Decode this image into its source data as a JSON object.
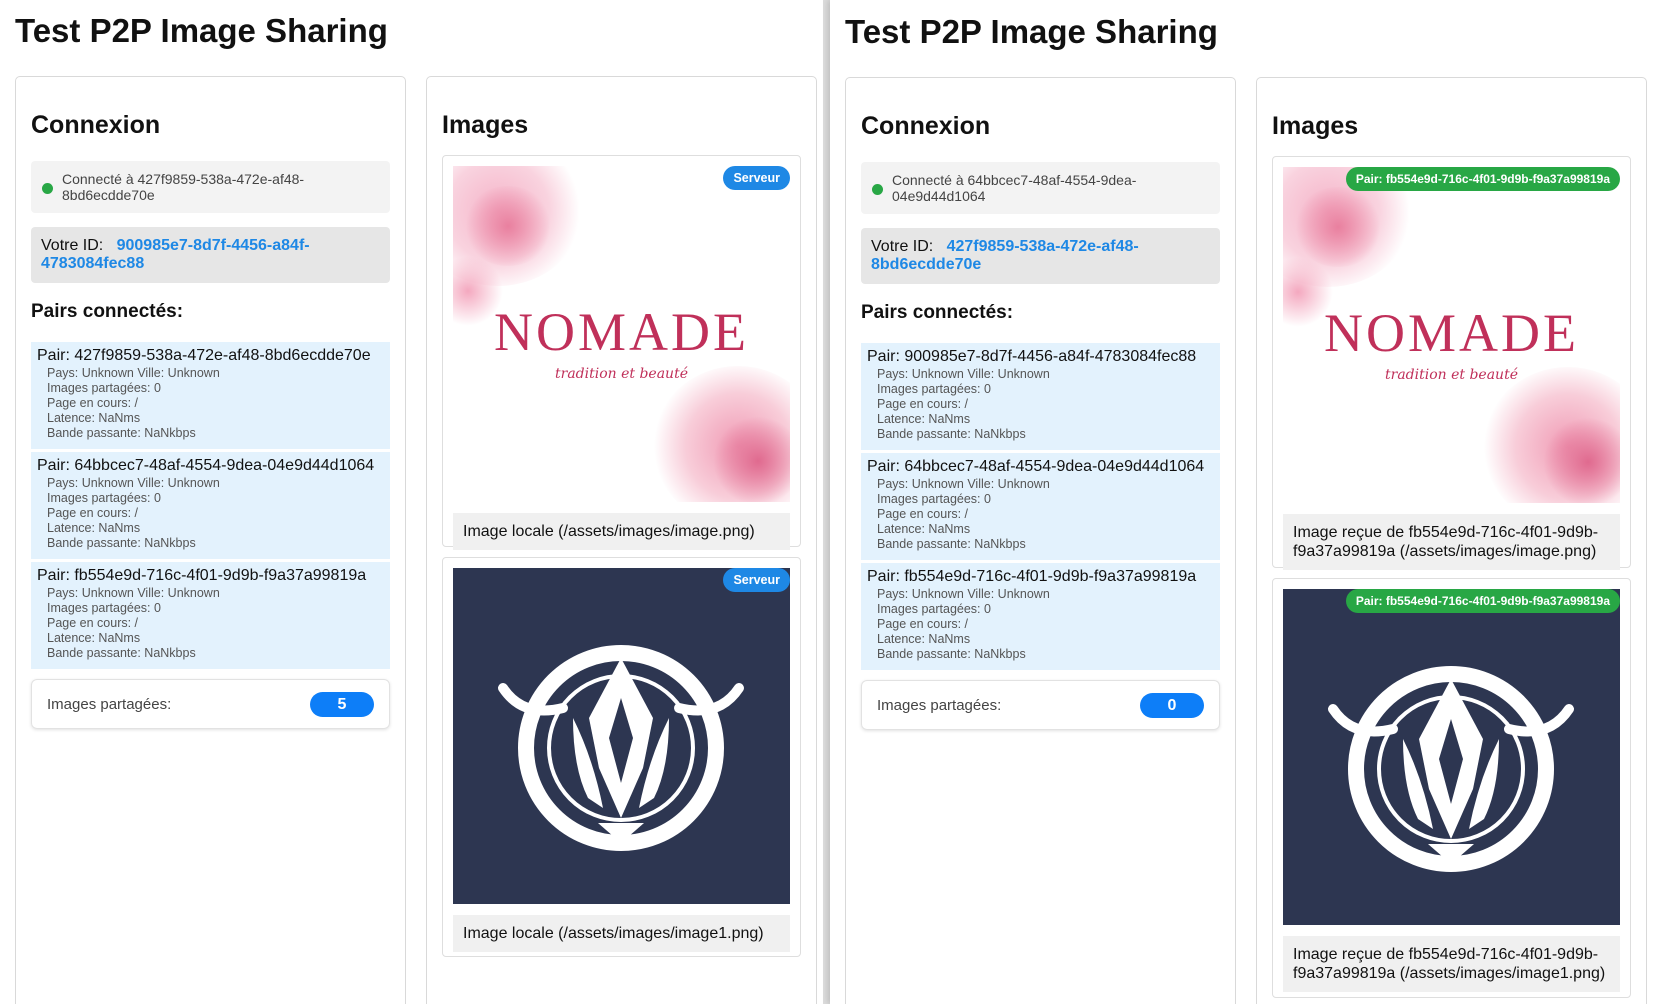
{
  "left": {
    "title": "Test P2P Image Sharing",
    "connection": {
      "heading": "Connexion",
      "status_text": "Connecté à 427f9859-538a-472e-af48-8bd6ecdde70e",
      "my_id_label": "Votre ID:",
      "my_id": "900985e7-8d7f-4456-a84f-4783084fec88",
      "peers_heading": "Pairs connectés:",
      "peers": [
        {
          "title": "Pair: 427f9859-538a-472e-af48-8bd6ecdde70e",
          "location": "Pays: Unknown Ville: Unknown",
          "shared": "Images partagées: 0",
          "page": "Page en cours: /",
          "latency": "Latence: NaNms",
          "bandwidth": "Bande passante: NaNkbps"
        },
        {
          "title": "Pair: 64bbcec7-48af-4554-9dea-04e9d44d1064",
          "location": "Pays: Unknown Ville: Unknown",
          "shared": "Images partagées: 0",
          "page": "Page en cours: /",
          "latency": "Latence: NaNms",
          "bandwidth": "Bande passante: NaNkbps"
        },
        {
          "title": "Pair: fb554e9d-716c-4f01-9d9b-f9a37a99819a",
          "location": "Pays: Unknown Ville: Unknown",
          "shared": "Images partagées: 0",
          "page": "Page en cours: /",
          "latency": "Latence: NaNms",
          "bandwidth": "Bande passante: NaNkbps"
        }
      ],
      "counter_label": "Images partagées:",
      "counter_value": "5"
    },
    "images": {
      "heading": "Images",
      "cards": [
        {
          "badge": "Serveur",
          "caption": "Image locale (/assets/images/image.png)",
          "logo_text": "NOMADE",
          "logo_sub": "tradition et beauté"
        },
        {
          "badge": "Serveur",
          "caption": "Image locale (/assets/images/image1.png)"
        }
      ]
    }
  },
  "right": {
    "title": "Test P2P Image Sharing",
    "connection": {
      "heading": "Connexion",
      "status_text": "Connecté à 64bbcec7-48af-4554-9dea-04e9d44d1064",
      "my_id_label": "Votre ID:",
      "my_id": "427f9859-538a-472e-af48-8bd6ecdde70e",
      "peers_heading": "Pairs connectés:",
      "peers": [
        {
          "title": "Pair: 900985e7-8d7f-4456-a84f-4783084fec88",
          "location": "Pays: Unknown Ville: Unknown",
          "shared": "Images partagées: 0",
          "page": "Page en cours: /",
          "latency": "Latence: NaNms",
          "bandwidth": "Bande passante: NaNkbps"
        },
        {
          "title": "Pair: 64bbcec7-48af-4554-9dea-04e9d44d1064",
          "location": "Pays: Unknown Ville: Unknown",
          "shared": "Images partagées: 0",
          "page": "Page en cours: /",
          "latency": "Latence: NaNms",
          "bandwidth": "Bande passante: NaNkbps"
        },
        {
          "title": "Pair: fb554e9d-716c-4f01-9d9b-f9a37a99819a",
          "location": "Pays: Unknown Ville: Unknown",
          "shared": "Images partagées: 0",
          "page": "Page en cours: /",
          "latency": "Latence: NaNms",
          "bandwidth": "Bande passante: NaNkbps"
        }
      ],
      "counter_label": "Images partagées:",
      "counter_value": "0"
    },
    "images": {
      "heading": "Images",
      "cards": [
        {
          "badge": "Pair: fb554e9d-716c-4f01-9d9b-f9a37a99819a",
          "caption": "Image reçue de fb554e9d-716c-4f01-9d9b-f9a37a99819a (/assets/images/image.png)",
          "logo_text": "NOMADE",
          "logo_sub": "tradition et beauté"
        },
        {
          "badge": "Pair: fb554e9d-716c-4f01-9d9b-f9a37a99819a",
          "caption": "Image reçue de fb554e9d-716c-4f01-9d9b-f9a37a99819a (/assets/images/image1.png)"
        }
      ]
    }
  },
  "colors": {
    "accent_blue": "#1e88e5",
    "status_green": "#28a745",
    "peer_bg": "#e3f2fd",
    "counter_blue": "#0d7ef8",
    "logo_pink": "#c0305a",
    "emblem_bg": "#2d3651"
  }
}
